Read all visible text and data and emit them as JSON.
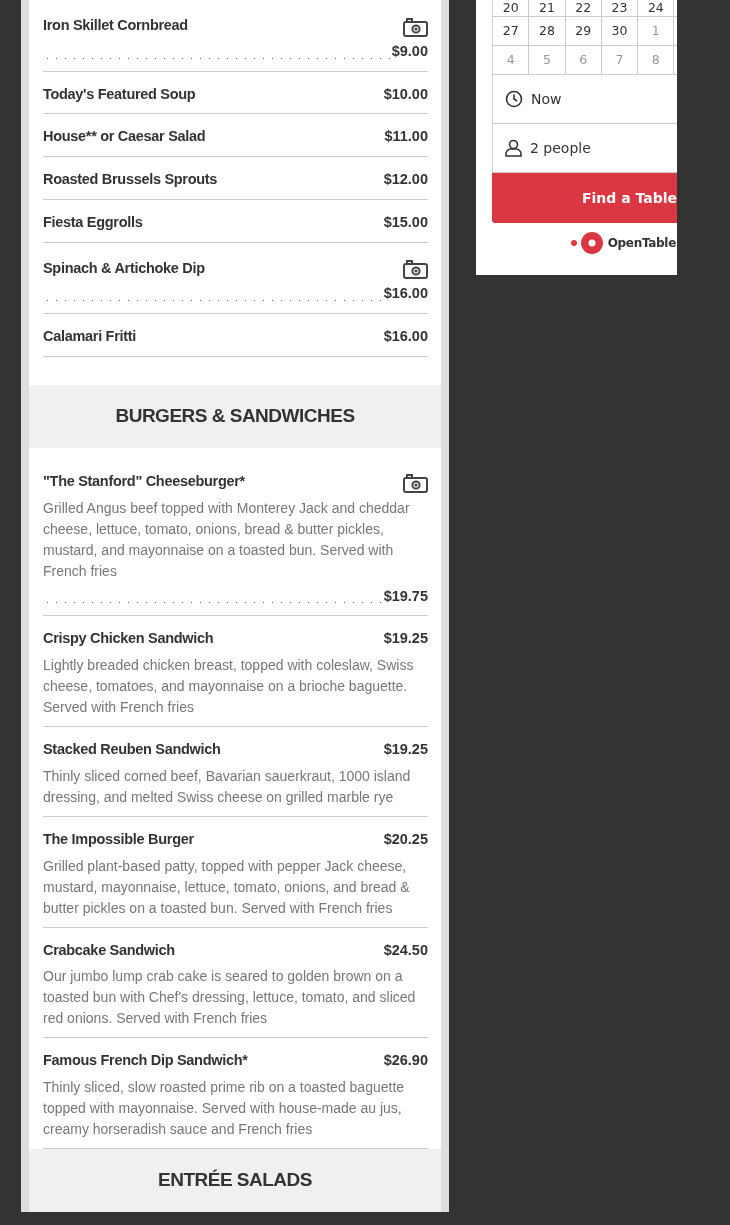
{
  "menu": {
    "sections": [
      {
        "items": [
          {
            "name": "Iron Skillet Cornbread",
            "price": "$9.00",
            "photo": true
          },
          {
            "name": "Today's Featured Soup",
            "price": "$10.00",
            "photo": false
          },
          {
            "name": "House** or Caesar Salad",
            "price": "$11.00",
            "photo": false
          },
          {
            "name": "Roasted Brussels Sprouts",
            "price": "$12.00",
            "photo": false
          },
          {
            "name": "Fiesta Eggrolls",
            "price": "$15.00",
            "photo": false
          },
          {
            "name": "Spinach & Artichoke Dip",
            "price": "$16.00",
            "photo": true
          },
          {
            "name": "Calamari Fritti",
            "price": "$16.00",
            "photo": false
          }
        ]
      },
      {
        "title": "BURGERS & SANDWICHES",
        "items": [
          {
            "name": "\"The Stanford\" Cheeseburger*",
            "description": "Grilled Angus beef topped with Monterey Jack and cheddar cheese, lettuce, tomato, onions, bread & butter pickles, mustard, and mayonnaise on a toasted bun. Served with French fries",
            "price": "$19.75",
            "photo": true
          },
          {
            "name": "Crispy Chicken Sandwich",
            "description": "Lightly breaded chicken breast, topped with coleslaw, Swiss cheese, tomatoes, and mayonnaise on a brioche baguette. Served with French fries",
            "price": "$19.25",
            "photo": false
          },
          {
            "name": "Stacked Reuben Sandwich",
            "description": "Thinly sliced corned beef, Bavarian sauerkraut, 1000 island dressing, and melted Swiss cheese on grilled marble rye",
            "price": "$19.25",
            "photo": false
          },
          {
            "name": "The Impossible Burger",
            "description": "Grilled plant-based patty, topped with pepper Jack cheese, mustard, mayonnaise, lettuce, tomato, onions, and bread & butter pickles on a toasted bun. Served with French fries",
            "price": "$20.25",
            "photo": false
          },
          {
            "name": "Crabcake Sandwich",
            "description": "Our jumbo lump crab cake is seared to golden brown on a toasted bun with Chef's dressing, lettuce, tomato, and sliced red onions. Served with French fries",
            "price": "$24.50",
            "photo": false
          },
          {
            "name": "Famous French Dip Sandwich*",
            "description": "Thinly sliced, slow roasted prime rib on a toasted baguette topped with mayonnaise. Served with house-made au jus, creamy horseradish sauce and French fries",
            "price": "$26.90",
            "photo": false
          }
        ]
      },
      {
        "title": "ENTRÉE SALADS"
      }
    ]
  },
  "reservation": {
    "calendar": [
      [
        {
          "day": "20",
          "muted": false
        },
        {
          "day": "21",
          "muted": false
        },
        {
          "day": "22",
          "muted": false
        },
        {
          "day": "23",
          "muted": false
        },
        {
          "day": "24",
          "muted": false
        }
      ],
      [
        {
          "day": "27",
          "muted": false
        },
        {
          "day": "28",
          "muted": false
        },
        {
          "day": "29",
          "muted": false
        },
        {
          "day": "30",
          "muted": false
        },
        {
          "day": "1",
          "muted": true
        }
      ],
      [
        {
          "day": "4",
          "muted": true
        },
        {
          "day": "5",
          "muted": true
        },
        {
          "day": "6",
          "muted": true
        },
        {
          "day": "7",
          "muted": true
        },
        {
          "day": "8",
          "muted": true
        }
      ]
    ],
    "time": "Now",
    "party": "2 people",
    "button": "Find a Table",
    "brand": "OpenTable"
  }
}
